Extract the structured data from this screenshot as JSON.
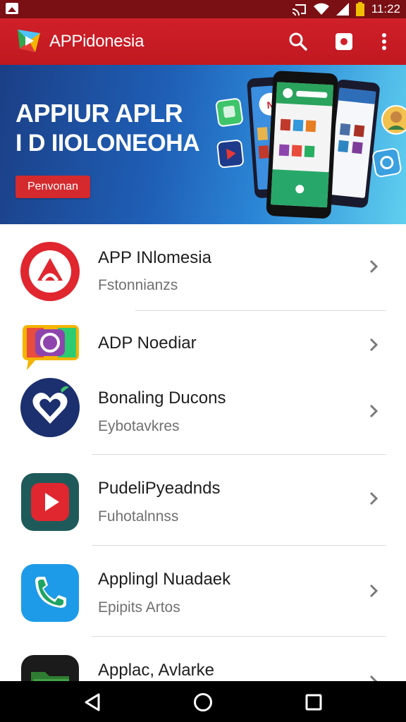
{
  "status_bar": {
    "time": "11:22",
    "icons": [
      "gallery-icon",
      "cast-icon",
      "wifi-icon",
      "signal-icon",
      "battery-icon"
    ]
  },
  "app_bar": {
    "title": "APPidonesia",
    "icons": [
      "app-logo-icon",
      "search-icon",
      "notification-icon",
      "more-vert-icon"
    ],
    "color": "#c81c24"
  },
  "banner": {
    "line1": "APPIUR APLR",
    "line2": "I D IIOLONEOHA",
    "button_label": "Penvonan"
  },
  "app_list": {
    "items": [
      {
        "title": "APP INlomesia",
        "subtitle": "Fstonnianzs",
        "icon": "red-circle-app-icon"
      },
      {
        "title": "ADP Noediar",
        "subtitle": "",
        "icon": "chat-bubble-app-icon"
      },
      {
        "title": "Bonaling Ducons",
        "subtitle": "Eybotavkres",
        "icon": "heart-app-icon"
      },
      {
        "title": "PudeliPyeadnds",
        "subtitle": "Fuhotalnnss",
        "icon": "play-app-icon"
      },
      {
        "title": "Applingl Nuadaek",
        "subtitle": "Epipits Artos",
        "icon": "phone-app-icon"
      },
      {
        "title": "Applac, Avlarke",
        "subtitle": "",
        "icon": "folder-app-icon"
      }
    ]
  },
  "nav_bar": {
    "icons": [
      "back-icon",
      "home-icon",
      "recents-icon"
    ]
  }
}
